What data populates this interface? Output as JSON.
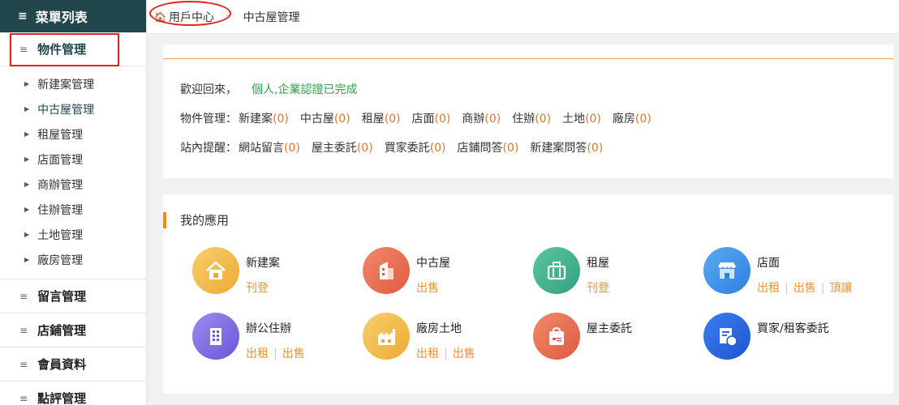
{
  "sidebar": {
    "header": "菜單列表",
    "sections": {
      "property": "物件管理",
      "messages": "留言管理",
      "shop": "店鋪管理",
      "member": "會員資料",
      "review": "點評管理"
    },
    "items": [
      {
        "label": "新建案管理"
      },
      {
        "label": "中古屋管理"
      },
      {
        "label": "租屋管理"
      },
      {
        "label": "店面管理"
      },
      {
        "label": "商辦管理"
      },
      {
        "label": "住辦管理"
      },
      {
        "label": "土地管理"
      },
      {
        "label": "廠房管理"
      }
    ]
  },
  "breadcrumb": {
    "home": "用戶中心",
    "current": "中古屋管理"
  },
  "welcome": {
    "greeting": "歡迎回來，",
    "status": "個人,企業認證已完成",
    "property_label": "物件管理：",
    "property_items": [
      {
        "label": "新建案",
        "count": "(0)"
      },
      {
        "label": "中古屋",
        "count": "(0)"
      },
      {
        "label": "租屋",
        "count": "(0)"
      },
      {
        "label": "店面",
        "count": "(0)"
      },
      {
        "label": "商辦",
        "count": "(0)"
      },
      {
        "label": "住辦",
        "count": "(0)"
      },
      {
        "label": "土地",
        "count": "(0)"
      },
      {
        "label": "廠房",
        "count": "(0)"
      }
    ],
    "reminder_label": "站內提醒：",
    "reminder_items": [
      {
        "label": "網站留言",
        "count": "(0)"
      },
      {
        "label": "屋主委託",
        "count": "(0)"
      },
      {
        "label": "買家委託",
        "count": "(0)"
      },
      {
        "label": "店鋪問答",
        "count": "(0)"
      },
      {
        "label": "新建案問答",
        "count": "(0)"
      }
    ]
  },
  "apps": {
    "title": "我的應用",
    "list": [
      {
        "name": "新建案",
        "links": [
          "刊登"
        ],
        "icon": "house-icon",
        "color": "#f0b93e"
      },
      {
        "name": "中古屋",
        "links": [
          "出售"
        ],
        "icon": "building-icon",
        "color": "#e8664d"
      },
      {
        "name": "租屋",
        "links": [
          "刊登"
        ],
        "icon": "suitcase-icon",
        "color": "#44b08d"
      },
      {
        "name": "店面",
        "links": [
          "出租",
          "出售",
          "頂讓"
        ],
        "icon": "storefront-icon",
        "color": "#3e8fe8"
      },
      {
        "name": "辦公住辦",
        "links": [
          "出租",
          "出售"
        ],
        "icon": "office-building-icon",
        "color": "#7f6de0"
      },
      {
        "name": "廠房土地",
        "links": [
          "出租",
          "出售"
        ],
        "icon": "factory-icon",
        "color": "#f0b93e"
      },
      {
        "name": "屋主委託",
        "links": [],
        "icon": "bag-icon",
        "color": "#e8664d"
      },
      {
        "name": "買家/租客委託",
        "links": [],
        "icon": "document-hand-icon",
        "color": "#2e6be0"
      }
    ]
  }
}
